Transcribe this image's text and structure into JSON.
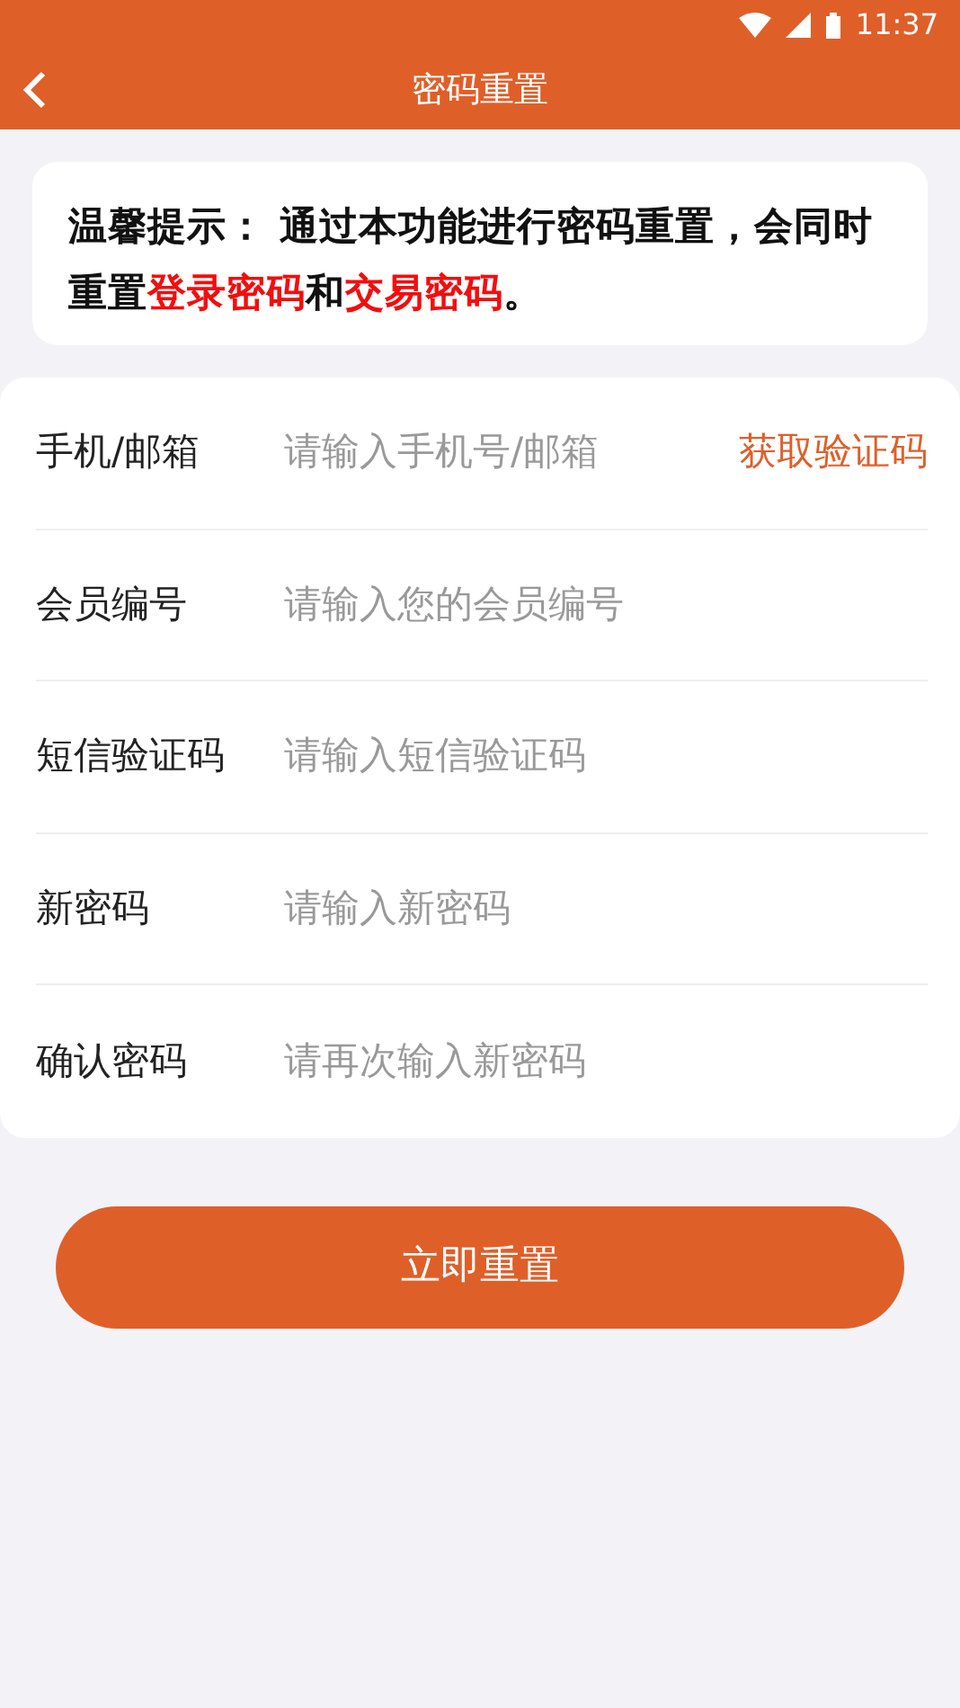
{
  "status_bar": {
    "time": "11:37"
  },
  "header": {
    "title": "密码重置"
  },
  "notice": {
    "parts": [
      {
        "text": "温馨提示： 通过本功能进行密码重置，会同时重置",
        "highlight": false
      },
      {
        "text": "登录密码",
        "highlight": true
      },
      {
        "text": "和",
        "highlight": false
      },
      {
        "text": "交易密码",
        "highlight": true
      },
      {
        "text": "。",
        "highlight": false
      }
    ]
  },
  "form": {
    "fields": [
      {
        "label": "手机/邮箱",
        "placeholder": "请输入手机号/邮箱",
        "action": "获取验证码"
      },
      {
        "label": "会员编号",
        "placeholder": "请输入您的会员编号"
      },
      {
        "label": "短信验证码",
        "placeholder": "请输入短信验证码"
      },
      {
        "label": "新密码",
        "placeholder": "请输入新密码"
      },
      {
        "label": "确认密码",
        "placeholder": "请再次输入新密码"
      }
    ]
  },
  "submit_button": "立即重置"
}
